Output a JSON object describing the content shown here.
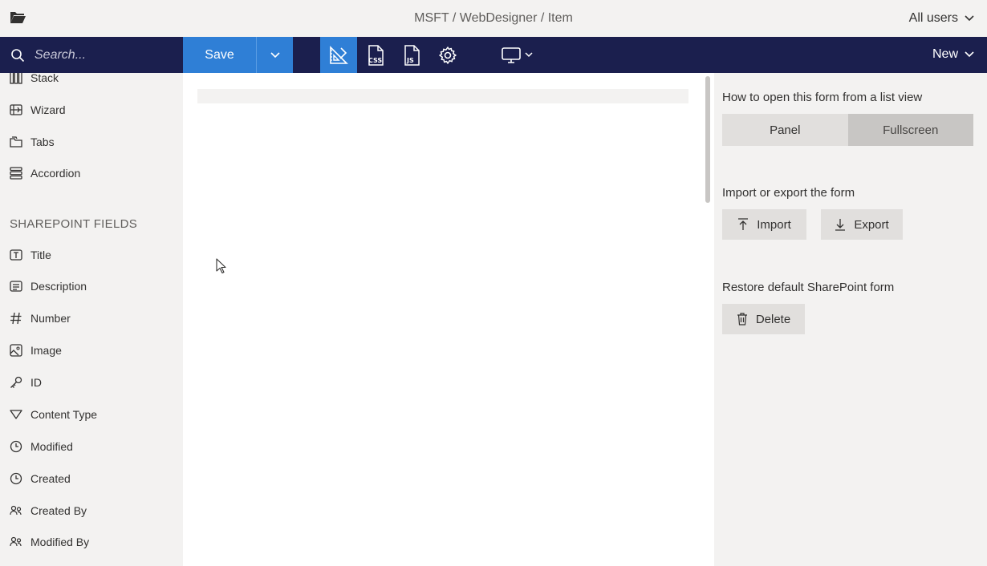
{
  "titlebar": {
    "path": "MSFT / WebDesigner / Item",
    "users_label": "All users"
  },
  "toolbar": {
    "search_placeholder": "Search...",
    "save_label": "Save",
    "new_label": "New"
  },
  "sidebar": {
    "layout_items": [
      {
        "label": "Stack",
        "icon": "columns-icon"
      },
      {
        "label": "Wizard",
        "icon": "wizard-icon"
      },
      {
        "label": "Tabs",
        "icon": "tabs-icon"
      },
      {
        "label": "Accordion",
        "icon": "accordion-icon"
      }
    ],
    "section_title": "SHAREPOINT FIELDS",
    "field_items": [
      {
        "label": "Title",
        "icon": "text-field-icon"
      },
      {
        "label": "Description",
        "icon": "multiline-text-icon"
      },
      {
        "label": "Number",
        "icon": "hash-icon"
      },
      {
        "label": "Image",
        "icon": "image-icon"
      },
      {
        "label": "ID",
        "icon": "key-icon"
      },
      {
        "label": "Content Type",
        "icon": "filter-icon"
      },
      {
        "label": "Modified",
        "icon": "clock-icon"
      },
      {
        "label": "Created",
        "icon": "clock-icon"
      },
      {
        "label": "Created By",
        "icon": "people-icon"
      },
      {
        "label": "Modified By",
        "icon": "people-icon"
      }
    ]
  },
  "right_panel": {
    "open_heading": "How to open this form from a list view",
    "open_options": [
      "Panel",
      "Fullscreen"
    ],
    "open_selected": "Fullscreen",
    "io_heading": "Import or export the form",
    "import_label": "Import",
    "export_label": "Export",
    "restore_heading": "Restore default SharePoint form",
    "delete_label": "Delete"
  }
}
